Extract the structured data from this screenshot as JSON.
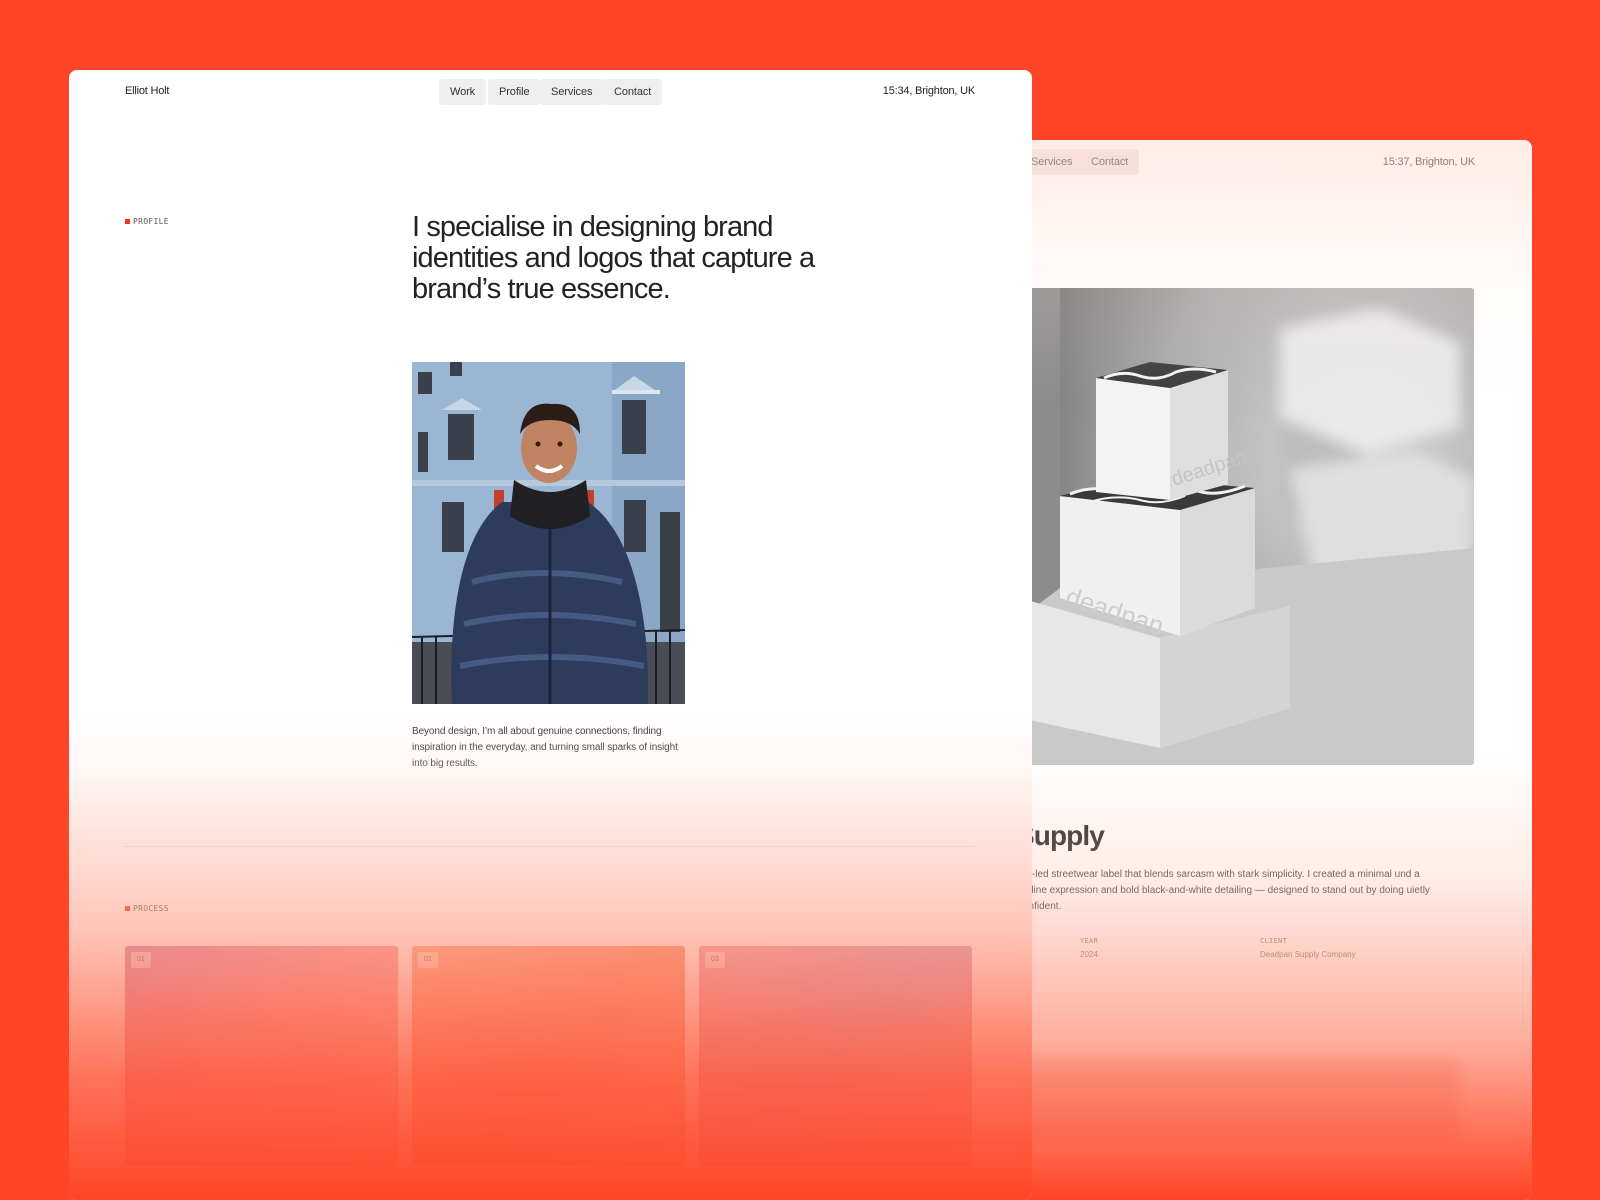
{
  "front_window": {
    "brand": "Elliot Holt",
    "nav": [
      "Work",
      "Profile",
      "Services",
      "Contact"
    ],
    "location_time": "15:34, Brighton, UK",
    "section_label": "PROFILE",
    "headline": "I specialise in designing brand identities and logos that capture a brand’s true essence.",
    "bio": "Beyond design, I’m all about genuine connections, finding inspiration in the everyday, and turning small sparks of insight into big results.",
    "process_label": "PROCESS",
    "process_cards": [
      "01",
      "02",
      "03"
    ]
  },
  "back_window": {
    "nav": [
      "Services",
      "Contact"
    ],
    "location_time": "15:37, Brighton, UK",
    "hero_box_text": "deadpan",
    "project_title": "Supply",
    "project_description": "ept-led streetwear label that blends sarcasm with stark simplicity. I created a minimal und a flatline expression and bold black-and-white detailing — designed to stand out by doing uietly confident.",
    "meta": {
      "year_label": "YEAR",
      "year_value": "2024",
      "client_label": "CLIENT",
      "client_value": "Deadpan Supply Company"
    }
  },
  "colors": {
    "background": "#ff4527",
    "accent": "#e83a1c"
  }
}
